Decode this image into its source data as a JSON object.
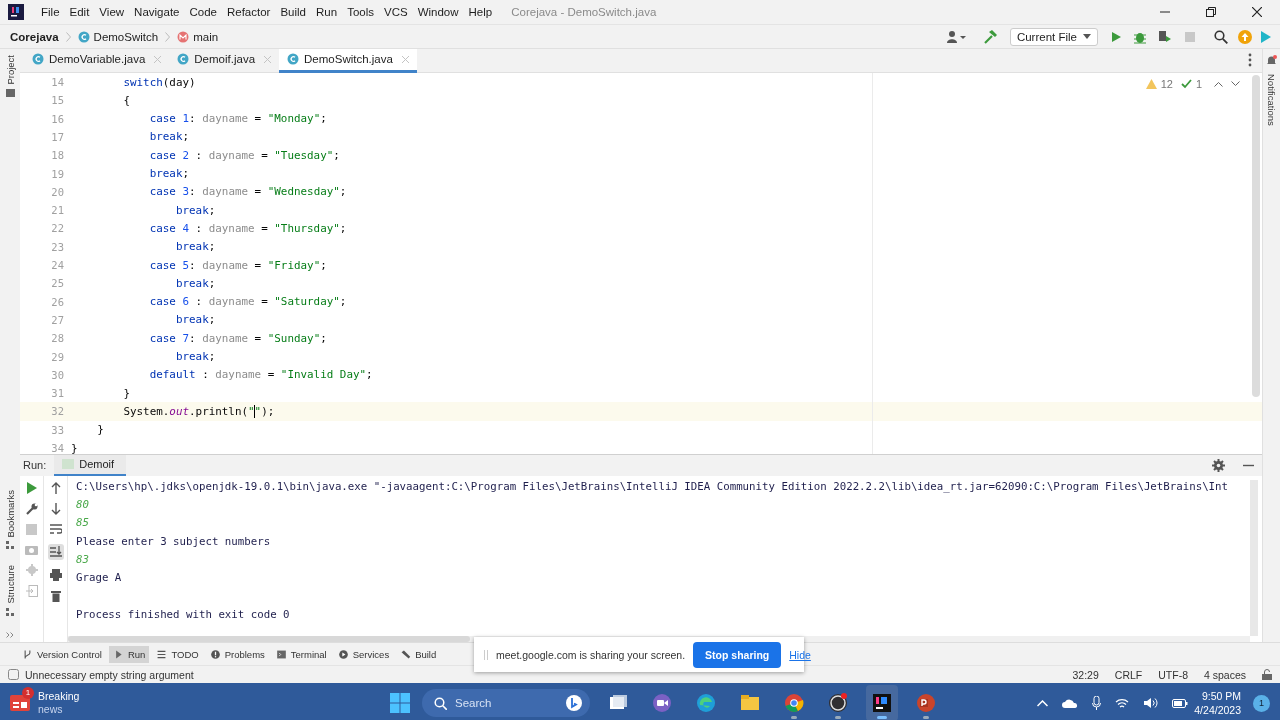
{
  "window": {
    "title": "Corejava - DemoSwitch.java"
  },
  "menu": [
    "File",
    "Edit",
    "View",
    "Navigate",
    "Code",
    "Refactor",
    "Build",
    "Run",
    "Tools",
    "VCS",
    "Window",
    "Help"
  ],
  "breadcrumbs": [
    {
      "label": "Corejava",
      "kind": "project"
    },
    {
      "label": "DemoSwitch",
      "kind": "class"
    },
    {
      "label": "main",
      "kind": "method"
    }
  ],
  "run_config": "Current File",
  "tabs": [
    {
      "label": "DemoVariable.java",
      "selected": false
    },
    {
      "label": "Demoif.java",
      "selected": false
    },
    {
      "label": "DemoSwitch.java",
      "selected": true
    }
  ],
  "left_strip": {
    "top": [
      "Project"
    ],
    "bottom": [
      "Bookmarks",
      "Structure"
    ]
  },
  "right_strip": [
    "Notifications"
  ],
  "editor": {
    "inspections": [
      {
        "kind": "warning",
        "count": "12"
      },
      {
        "kind": "ok",
        "count": "1"
      }
    ],
    "lines": [
      {
        "number": "14",
        "current": false,
        "tokens": [
          {
            "text": "        switch",
            "kind": "keyword"
          },
          {
            "text": "(day)",
            "kind": "plain"
          }
        ]
      },
      {
        "number": "15",
        "current": false,
        "tokens": [
          {
            "text": "        {",
            "kind": "plain"
          }
        ]
      },
      {
        "number": "16",
        "current": false,
        "tokens": [
          {
            "text": "            case ",
            "kind": "keyword"
          },
          {
            "text": "1",
            "kind": "number"
          },
          {
            "text": ": ",
            "kind": "plain"
          },
          {
            "text": "dayname",
            "kind": "variable"
          },
          {
            "text": " = ",
            "kind": "plain"
          },
          {
            "text": "\"Monday\"",
            "kind": "string"
          },
          {
            "text": ";",
            "kind": "plain"
          }
        ]
      },
      {
        "number": "17",
        "current": false,
        "tokens": [
          {
            "text": "            break",
            "kind": "keyword"
          },
          {
            "text": ";",
            "kind": "plain"
          }
        ]
      },
      {
        "number": "18",
        "current": false,
        "tokens": [
          {
            "text": "            case ",
            "kind": "keyword"
          },
          {
            "text": "2",
            "kind": "number"
          },
          {
            "text": " : ",
            "kind": "plain"
          },
          {
            "text": "dayname",
            "kind": "variable"
          },
          {
            "text": " = ",
            "kind": "plain"
          },
          {
            "text": "\"Tuesday\"",
            "kind": "string"
          },
          {
            "text": ";",
            "kind": "plain"
          }
        ]
      },
      {
        "number": "19",
        "current": false,
        "tokens": [
          {
            "text": "            break",
            "kind": "keyword"
          },
          {
            "text": ";",
            "kind": "plain"
          }
        ]
      },
      {
        "number": "20",
        "current": false,
        "tokens": [
          {
            "text": "            case ",
            "kind": "keyword"
          },
          {
            "text": "3",
            "kind": "number"
          },
          {
            "text": ": ",
            "kind": "plain"
          },
          {
            "text": "dayname",
            "kind": "variable"
          },
          {
            "text": " = ",
            "kind": "plain"
          },
          {
            "text": "\"Wednesday\"",
            "kind": "string"
          },
          {
            "text": ";",
            "kind": "plain"
          }
        ]
      },
      {
        "number": "21",
        "current": false,
        "tokens": [
          {
            "text": "                break",
            "kind": "keyword"
          },
          {
            "text": ";",
            "kind": "plain"
          }
        ]
      },
      {
        "number": "22",
        "current": false,
        "tokens": [
          {
            "text": "            case ",
            "kind": "keyword"
          },
          {
            "text": "4",
            "kind": "number"
          },
          {
            "text": " : ",
            "kind": "plain"
          },
          {
            "text": "dayname",
            "kind": "variable"
          },
          {
            "text": " = ",
            "kind": "plain"
          },
          {
            "text": "\"Thursday\"",
            "kind": "string"
          },
          {
            "text": ";",
            "kind": "plain"
          }
        ]
      },
      {
        "number": "23",
        "current": false,
        "tokens": [
          {
            "text": "                break",
            "kind": "keyword"
          },
          {
            "text": ";",
            "kind": "plain"
          }
        ]
      },
      {
        "number": "24",
        "current": false,
        "tokens": [
          {
            "text": "            case ",
            "kind": "keyword"
          },
          {
            "text": "5",
            "kind": "number"
          },
          {
            "text": ": ",
            "kind": "plain"
          },
          {
            "text": "dayname",
            "kind": "variable"
          },
          {
            "text": " = ",
            "kind": "plain"
          },
          {
            "text": "\"Friday\"",
            "kind": "string"
          },
          {
            "text": ";",
            "kind": "plain"
          }
        ]
      },
      {
        "number": "25",
        "current": false,
        "tokens": [
          {
            "text": "                break",
            "kind": "keyword"
          },
          {
            "text": ";",
            "kind": "plain"
          }
        ]
      },
      {
        "number": "26",
        "current": false,
        "tokens": [
          {
            "text": "            case ",
            "kind": "keyword"
          },
          {
            "text": "6",
            "kind": "number"
          },
          {
            "text": " : ",
            "kind": "plain"
          },
          {
            "text": "dayname",
            "kind": "variable"
          },
          {
            "text": " = ",
            "kind": "plain"
          },
          {
            "text": "\"Saturday\"",
            "kind": "string"
          },
          {
            "text": ";",
            "kind": "plain"
          }
        ]
      },
      {
        "number": "27",
        "current": false,
        "tokens": [
          {
            "text": "                break",
            "kind": "keyword"
          },
          {
            "text": ";",
            "kind": "plain"
          }
        ]
      },
      {
        "number": "28",
        "current": false,
        "tokens": [
          {
            "text": "            case ",
            "kind": "keyword"
          },
          {
            "text": "7",
            "kind": "number"
          },
          {
            "text": ": ",
            "kind": "plain"
          },
          {
            "text": "dayname",
            "kind": "variable"
          },
          {
            "text": " = ",
            "kind": "plain"
          },
          {
            "text": "\"Sunday\"",
            "kind": "string"
          },
          {
            "text": ";",
            "kind": "plain"
          }
        ]
      },
      {
        "number": "29",
        "current": false,
        "tokens": [
          {
            "text": "                break",
            "kind": "keyword"
          },
          {
            "text": ";",
            "kind": "plain"
          }
        ]
      },
      {
        "number": "30",
        "current": false,
        "tokens": [
          {
            "text": "            default",
            "kind": "keyword"
          },
          {
            "text": " : ",
            "kind": "plain"
          },
          {
            "text": "dayname",
            "kind": "variable"
          },
          {
            "text": " = ",
            "kind": "plain"
          },
          {
            "text": "\"Invalid Day\"",
            "kind": "string"
          },
          {
            "text": ";",
            "kind": "plain"
          }
        ]
      },
      {
        "number": "31",
        "current": false,
        "tokens": [
          {
            "text": "        }",
            "kind": "plain"
          }
        ]
      },
      {
        "number": "32",
        "current": true,
        "tokens": [
          {
            "text": "        System.",
            "kind": "plain"
          },
          {
            "text": "out",
            "kind": "static"
          },
          {
            "text": ".println(",
            "kind": "plain"
          },
          {
            "text": "\"",
            "kind": "string",
            "caret_after": true
          },
          {
            "text": "\"",
            "kind": "string"
          },
          {
            "text": ");",
            "kind": "plain"
          }
        ]
      },
      {
        "number": "33",
        "current": false,
        "tokens": [
          {
            "text": "    }",
            "kind": "plain"
          }
        ]
      },
      {
        "number": "34",
        "current": false,
        "tokens": [
          {
            "text": "}",
            "kind": "plain"
          }
        ]
      }
    ]
  },
  "run_panel": {
    "label": "Run:",
    "tabs": [
      {
        "label": "Demoif",
        "selected": true
      }
    ],
    "output": [
      {
        "kind": "command",
        "text": "C:\\Users\\hp\\.jdks\\openjdk-19.0.1\\bin\\java.exe \"-javaagent:C:\\Program Files\\JetBrains\\IntelliJ IDEA Community Edition 2022.2.2\\lib\\idea_rt.jar=62090:C:\\Program Files\\JetBrains\\Int"
      },
      {
        "kind": "input",
        "text": "80"
      },
      {
        "kind": "input",
        "text": "85"
      },
      {
        "kind": "output",
        "text": "Please enter 3 subject numbers"
      },
      {
        "kind": "input",
        "text": "83"
      },
      {
        "kind": "output",
        "text": "Grage A"
      },
      {
        "kind": "blank"
      },
      {
        "kind": "output",
        "text": "Process finished with exit code 0"
      }
    ]
  },
  "tool_windows": [
    {
      "label": "Version Control",
      "kind": "vcs",
      "selected": false
    },
    {
      "label": "Run",
      "kind": "run",
      "selected": true
    },
    {
      "label": "TODO",
      "kind": "todo",
      "selected": false
    },
    {
      "label": "Problems",
      "kind": "problems",
      "selected": false
    },
    {
      "label": "Terminal",
      "kind": "terminal",
      "selected": false
    },
    {
      "label": "Services",
      "kind": "services",
      "selected": false
    },
    {
      "label": "Build",
      "kind": "build",
      "selected": false
    }
  ],
  "status_bar": {
    "message": "Unnecessary empty string argument",
    "items": [
      "32:29",
      "CRLF",
      "UTF-8",
      "4 spaces"
    ]
  },
  "share_banner": {
    "message": "meet.google.com is sharing your screen.",
    "stop": "Stop sharing",
    "hide": "Hide"
  },
  "taskbar": {
    "news": {
      "title": "Breaking",
      "subtitle": "news",
      "badge": "1"
    },
    "search": {
      "placeholder": "Search"
    },
    "apps": [
      {
        "kind": "task-view",
        "running": false,
        "selected": false
      },
      {
        "kind": "video-call",
        "running": false,
        "selected": false
      },
      {
        "kind": "edge",
        "running": false,
        "selected": false
      },
      {
        "kind": "folder",
        "running": false,
        "selected": false
      },
      {
        "kind": "chrome",
        "running": true,
        "selected": false
      },
      {
        "kind": "obs",
        "running": true,
        "selected": false
      },
      {
        "kind": "intellij",
        "running": true,
        "selected": true
      },
      {
        "kind": "powerpoint",
        "running": true,
        "selected": false
      }
    ],
    "clock": {
      "time": "9:50 PM",
      "date": "4/24/2023"
    },
    "notifications": "1"
  }
}
